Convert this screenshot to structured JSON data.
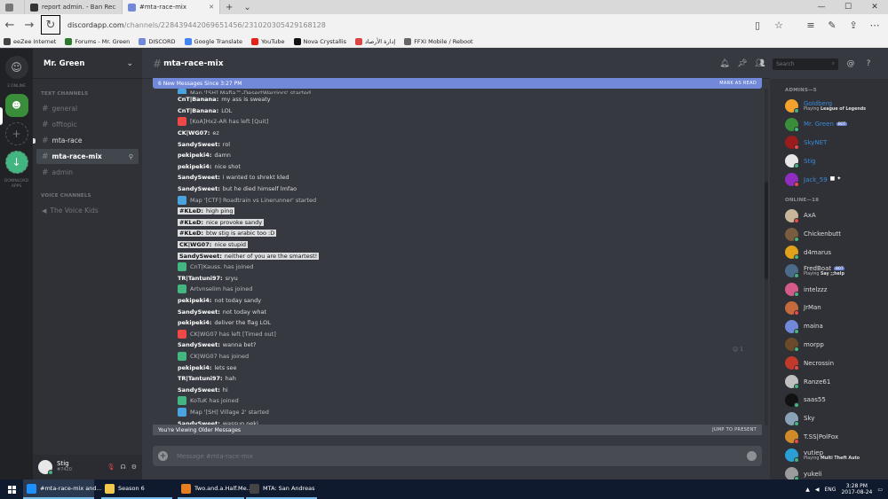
{
  "browser": {
    "tabs": [
      {
        "label": "report admin. - Ban Rec",
        "active": false
      },
      {
        "label": "#mta-race-mix",
        "active": true
      }
    ],
    "url_host": "discordapp.com",
    "url_path": "/channels/228439442069651456/231020305429168128",
    "favorites": [
      "eeZee Internet",
      "Forums - Mr. Green",
      "DISCORD",
      "Google Translate",
      "YouTube",
      "Nova Crystallis",
      "إدارة الأرصاد",
      "FFXI Mobile / Reboot"
    ]
  },
  "guilds": {
    "online_label": "3 ONLINE",
    "download_label": "DOWNLOAD APPS"
  },
  "server": {
    "name": "Mr. Green",
    "text_category": "TEXT CHANNELS",
    "voice_category": "VOICE CHANNELS",
    "text_channels": [
      "general",
      "offtopic",
      "mta-race",
      "mta-race-mix",
      "admin"
    ],
    "voice_channels": [
      "The Voice Kids"
    ]
  },
  "user": {
    "name": "Stig",
    "discriminator": "#7420"
  },
  "chat": {
    "channel": "mta-race-mix",
    "new_messages": "6 New Messages Since 3:27 PM",
    "mark_as_read": "MARK AS READ",
    "older_notice": "You're Viewing Older Messages",
    "jump": "JUMP TO PRESENT",
    "composer_placeholder": "Message #mta-race-mix",
    "search_placeholder": "Search",
    "reaction_count": "1",
    "messages": [
      {
        "type": "map",
        "text": "Map '[SH] Mafia™-DesertWarriors' started",
        "partial": true
      },
      {
        "author": "CnT|Banana:",
        "text": "my ass is sweaty"
      },
      {
        "author": "CnT|Banana:",
        "text": "LOL"
      },
      {
        "type": "leave",
        "text": "[KoA]Hx2-AR has left [Quit]"
      },
      {
        "author": "CK|WG07:",
        "text": "ez"
      },
      {
        "author": "SandySweet:",
        "text": "rol"
      },
      {
        "author": "pekipeki4:",
        "text": "damn"
      },
      {
        "author": "pekipeki4:",
        "text": "nice shot"
      },
      {
        "author": "SandySweet:",
        "text": "i wanted to shrekt kled"
      },
      {
        "author": "SandySweet:",
        "text": "but he died himself lmfao"
      },
      {
        "type": "map",
        "text": "Map '[CTF] Roadtrain vs Linerunner' started"
      },
      {
        "author": "#KLeD:",
        "text": "high ping",
        "hl": true
      },
      {
        "author": "#KLeD:",
        "text": "nice provoke sandy",
        "hl": true
      },
      {
        "author": "#KLeD:",
        "text": "btw stig is arabic too :D",
        "hl": true
      },
      {
        "author": "CK|WG07:",
        "text": "nice stupid",
        "hl": true
      },
      {
        "author": "SandySweet:",
        "text": "neither of you are the smartest!",
        "hl": true
      },
      {
        "type": "join",
        "text": "CnT|Kauss. has joined"
      },
      {
        "author": "TR|Tantuni97:",
        "text": "sryu"
      },
      {
        "type": "join",
        "text": "Artvnselim has joined"
      },
      {
        "author": "pekipeki4:",
        "text": "not today sandy"
      },
      {
        "author": "SandySweet:",
        "text": "not today what"
      },
      {
        "author": "pekipeki4:",
        "text": "deliver the flag LOL"
      },
      {
        "type": "leave",
        "text": "CK|WG07 has left [Timed out]"
      },
      {
        "author": "SandySweet:",
        "text": "wanna bet?"
      },
      {
        "type": "join",
        "text": "CK|WG07 has joined"
      },
      {
        "author": "pekipeki4:",
        "text": "lets see"
      },
      {
        "author": "TR|Tantuni97:",
        "text": "hah"
      },
      {
        "author": "SandySweet:",
        "text": "hi"
      },
      {
        "type": "join",
        "text": "KoTuK has joined"
      },
      {
        "type": "map",
        "text": "Map '[SH] Village 2' started"
      },
      {
        "author": "SandySweet:",
        "text": "wassup peki"
      }
    ]
  },
  "members": {
    "admins_label": "ADMINS—5",
    "online_label": "ONLINE—18",
    "admins": [
      {
        "name": "Goldberg",
        "game_prefix": "Playing",
        "game": "League of Legends",
        "color": "#f4a22d",
        "status": "online"
      },
      {
        "name": "Mr. Green",
        "bot": "BOT",
        "color": "#3a8d3a",
        "status": "online"
      },
      {
        "name": "SkyNET",
        "color": "#9b1c1c",
        "status": "dnd"
      },
      {
        "name": "Stig",
        "color": "#e7e7e7",
        "status": "online"
      },
      {
        "name": "Jack_59",
        "color": "#8e2dbf",
        "status": "dnd",
        "extra": "■ ✦"
      }
    ],
    "online": [
      {
        "name": "AxA",
        "color": "#c8b69a",
        "status": "dnd"
      },
      {
        "name": "Chickenbutt",
        "color": "#7a5c3e",
        "status": "online"
      },
      {
        "name": "d4marus",
        "color": "#e0a21a",
        "status": "online"
      },
      {
        "name": "FredBoat",
        "bot": "BOT",
        "game_prefix": "Playing",
        "game": "Say ;;help",
        "color": "#4b6b8a",
        "status": "online"
      },
      {
        "name": "intelzzz",
        "color": "#d45a8a",
        "status": "online"
      },
      {
        "name": "JrMan",
        "color": "#c56a3c",
        "status": "dnd"
      },
      {
        "name": "maina",
        "color": "#7289da",
        "status": "online"
      },
      {
        "name": "morpp",
        "color": "#6b4a2a",
        "status": "online"
      },
      {
        "name": "Necrossin",
        "color": "#c0392b",
        "status": "dnd"
      },
      {
        "name": "Ranze61",
        "color": "#bfbfbf",
        "status": "online"
      },
      {
        "name": "saas55",
        "color": "#111111",
        "status": "online"
      },
      {
        "name": "Sky",
        "color": "#8aa2b8",
        "status": "online"
      },
      {
        "name": "T.SS|PolFox",
        "color": "#d08a2a",
        "status": "dnd"
      },
      {
        "name": "vutiep",
        "game_prefix": "Playing",
        "game": "Multi Theft Auto",
        "color": "#2a9fd6",
        "status": "online"
      },
      {
        "name": "yukeli",
        "color": "#9b9b9b",
        "status": "online"
      }
    ]
  },
  "taskbar": {
    "apps": [
      {
        "label": "#mta-race-mix and...",
        "color": "#1e90ff",
        "active": true
      },
      {
        "label": "Season 6",
        "color": "#f2c94c",
        "active": false
      },
      {
        "label": "Two.and.a.Half.Me...",
        "color": "#e67e22",
        "active": false
      },
      {
        "label": "MTA: San Andreas",
        "color": "#444444",
        "active": false
      }
    ],
    "lang": "ENG",
    "time": "3:28 PM",
    "date": "2017-08-24"
  }
}
